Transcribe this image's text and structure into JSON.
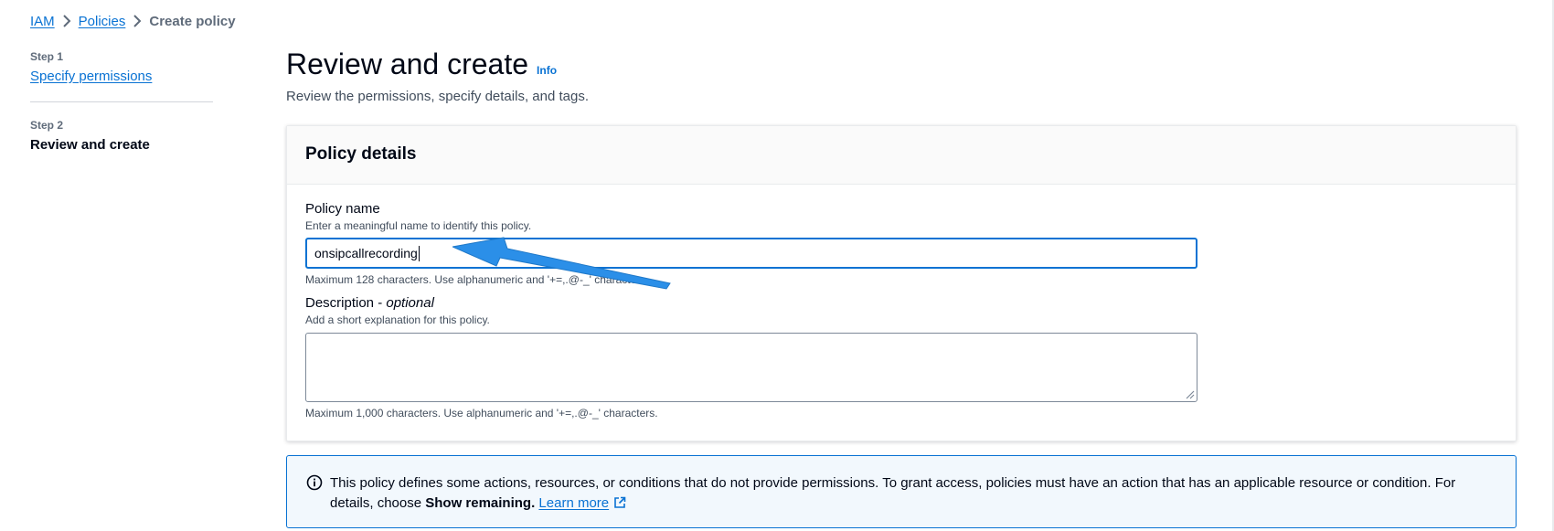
{
  "breadcrumb": {
    "items": [
      "IAM",
      "Policies"
    ],
    "current": "Create policy"
  },
  "wizard": {
    "step1_number": "Step 1",
    "step1_label": "Specify permissions",
    "step2_number": "Step 2",
    "step2_label": "Review and create"
  },
  "header": {
    "title": "Review and create",
    "info_link": "Info",
    "subtitle": "Review the permissions, specify details, and tags."
  },
  "policy_details": {
    "title": "Policy details",
    "name": {
      "label": "Policy name",
      "description": "Enter a meaningful name to identify this policy.",
      "value": "onsipcallrecording",
      "constraint": "Maximum 128 characters. Use alphanumeric and '+=,.@-_' characters."
    },
    "description": {
      "label": "Description - ",
      "label_optional": "optional",
      "description": "Add a short explanation for this policy.",
      "value": "",
      "constraint": "Maximum 1,000 characters. Use alphanumeric and '+=,.@-_' characters."
    }
  },
  "alert": {
    "text_start": "This policy defines some actions, resources, or conditions that do not provide permissions. To grant access, policies must have an action that has an applicable resource or condition. For details, choose ",
    "bold_text": "Show remaining.",
    "link_text": "Learn more"
  },
  "icons": {
    "breadcrumb_separator": "chevron-right-icon",
    "alert": "info-icon",
    "external_link": "external-link-icon",
    "annotation": "arrow-annotation-icon"
  },
  "colors": {
    "link": "#0972d3",
    "alert_bg": "#f2f8fd",
    "annotation_arrow": "#2b8fe8"
  }
}
